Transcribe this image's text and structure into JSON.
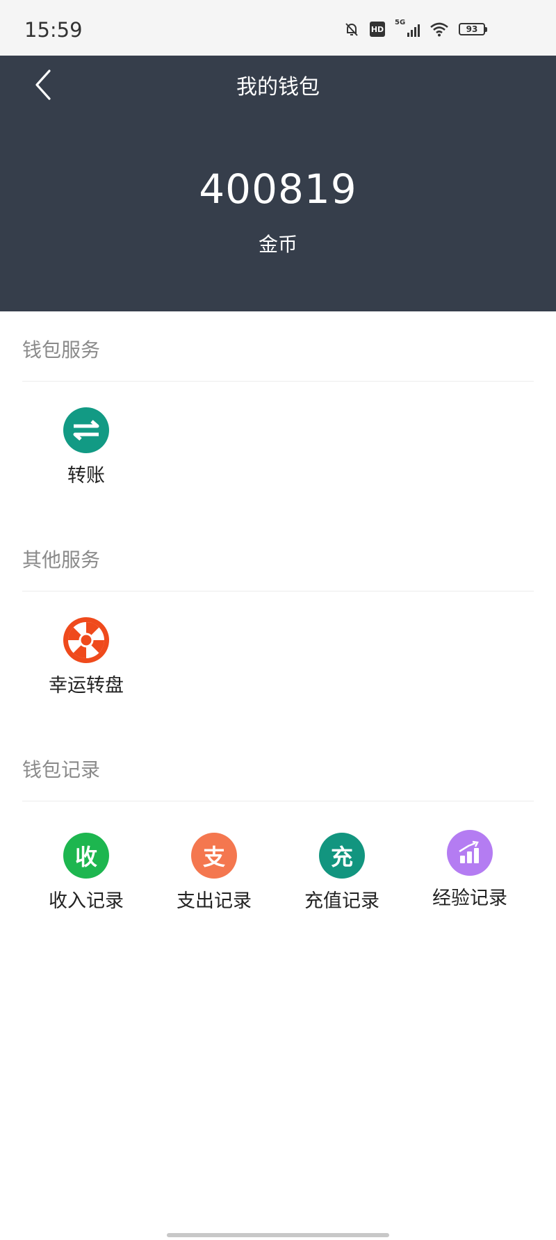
{
  "status_bar": {
    "time": "15:59",
    "hd_label": "HD",
    "network_label": "5G",
    "battery_level": "93",
    "icons": [
      "bell-off-icon",
      "hd-icon",
      "signal-5g-icon",
      "wifi-icon",
      "battery-icon"
    ]
  },
  "header": {
    "title": "我的钱包",
    "back_icon": "chevron-left-icon",
    "balance": "400819",
    "unit": "金币",
    "background": "#363e4b"
  },
  "sections": {
    "wallet_services": {
      "title": "钱包服务",
      "items": [
        {
          "label": "转账",
          "icon": "transfer-icon",
          "color": "#129a84"
        }
      ]
    },
    "other_services": {
      "title": "其他服务",
      "items": [
        {
          "label": "幸运转盘",
          "icon": "wheel-icon",
          "color": "#ef4a1c"
        }
      ]
    },
    "wallet_records": {
      "title": "钱包记录",
      "items": [
        {
          "label": "收入记录",
          "glyph": "收",
          "icon": "income-icon",
          "color": "#1db64f"
        },
        {
          "label": "支出记录",
          "glyph": "支",
          "icon": "expense-icon",
          "color": "#f4774f"
        },
        {
          "label": "充值记录",
          "glyph": "充",
          "icon": "recharge-icon",
          "color": "#12957f"
        },
        {
          "label": "经验记录",
          "icon": "experience-chart-icon",
          "color": "#b47cf2"
        }
      ]
    }
  }
}
